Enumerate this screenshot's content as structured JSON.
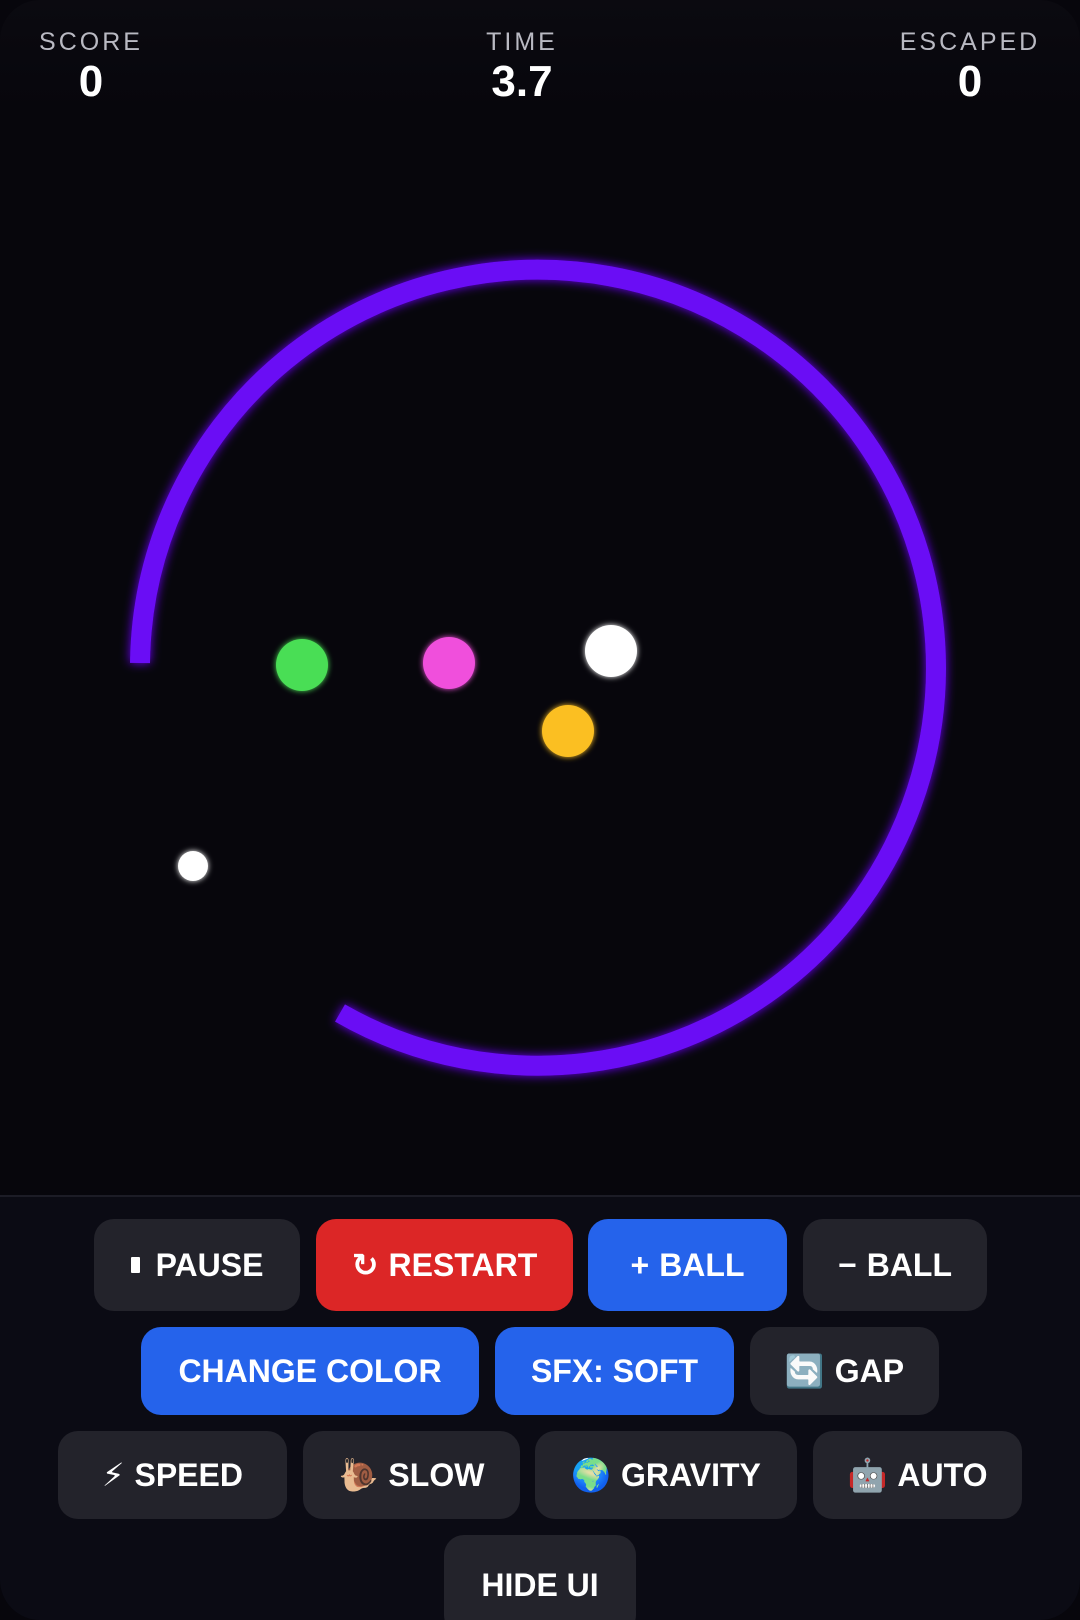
{
  "hud": {
    "score_label": "SCORE",
    "score_value": "0",
    "time_label": "TIME",
    "time_value": "3.7",
    "escaped_label": "ESCAPED",
    "escaped_value": "0"
  },
  "arena": {
    "ring_color": "#6a0af5",
    "balls": [
      {
        "name": "green-ball",
        "color": "#4ade55"
      },
      {
        "name": "pink-ball",
        "color": "#f04fdc"
      },
      {
        "name": "white-ball",
        "color": "#ffffff"
      },
      {
        "name": "yellow-ball",
        "color": "#fbbf24"
      },
      {
        "name": "small-white-ball",
        "color": "#ffffff"
      }
    ]
  },
  "controls": {
    "pause": {
      "icon": "pause-icon",
      "label": "PAUSE"
    },
    "restart": {
      "icon": "restart-icon",
      "glyph": "↻",
      "label": "RESTART"
    },
    "add_ball": {
      "icon": "plus-icon",
      "glyph": "+",
      "label": "BALL"
    },
    "remove_ball": {
      "icon": "minus-icon",
      "glyph": "−",
      "label": "BALL"
    },
    "change_color": {
      "label": "CHANGE COLOR"
    },
    "sfx": {
      "label": "SFX: SOFT"
    },
    "gap": {
      "icon": "cycle-icon",
      "glyph": "🔄",
      "label": "GAP"
    },
    "speed": {
      "icon": "lightning-icon",
      "glyph": "⚡",
      "label": "SPEED"
    },
    "slow": {
      "icon": "snail-icon",
      "glyph": "🐌",
      "label": "SLOW"
    },
    "gravity": {
      "icon": "globe-icon",
      "glyph": "🌍",
      "label": "GRAVITY"
    },
    "auto": {
      "icon": "robot-icon",
      "glyph": "🤖",
      "label": "AUTO"
    },
    "hide_ui": {
      "label": "HIDE UI"
    },
    "colors": {
      "dark": "#23232b",
      "red": "#dc2626",
      "blue": "#2563eb"
    }
  }
}
